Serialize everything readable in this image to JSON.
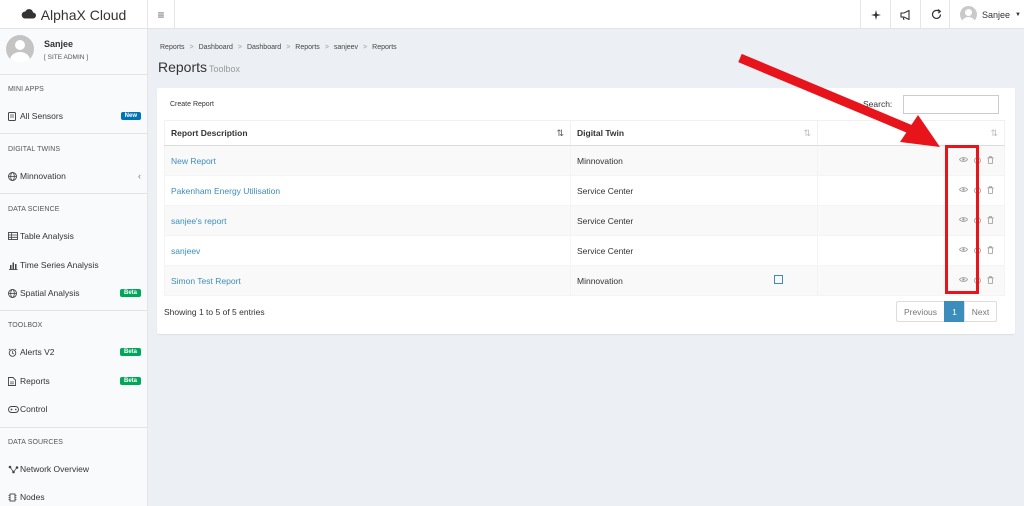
{
  "app": {
    "brand": "AlphaX Cloud",
    "user_menu_name": "Sanjee"
  },
  "sidebar": {
    "user": {
      "name": "Sanjee",
      "role": "[ SITE ADMIN ]"
    },
    "sections": {
      "mini_apps": "MINI APPS",
      "digital_twins": "DIGITAL TWINS",
      "data_science": "DATA SCIENCE",
      "toolbox": "TOOLBOX",
      "data_sources": "DATA SOURCES"
    },
    "items": {
      "all_sensors": {
        "label": "All Sensors",
        "badge": "New"
      },
      "minnovation": {
        "label": "Minnovation"
      },
      "table_analysis": {
        "label": "Table Analysis"
      },
      "time_series": {
        "label": "Time Series Analysis"
      },
      "spatial": {
        "label": "Spatial Analysis",
        "badge": "Beta"
      },
      "alerts": {
        "label": "Alerts V2",
        "badge": "Beta"
      },
      "reports": {
        "label": "Reports",
        "badge": "Beta"
      },
      "control": {
        "label": "Control"
      },
      "network": {
        "label": "Network Overview"
      },
      "nodes": {
        "label": "Nodes"
      }
    }
  },
  "breadcrumb": [
    "Reports",
    "Dashboard",
    "Dashboard",
    "Reports",
    "sanjeev",
    "Reports"
  ],
  "page": {
    "title": "Reports",
    "subtitle": "Toolbox"
  },
  "box": {
    "create_label": "Create Report",
    "search_label": "Search:",
    "search_value": ""
  },
  "table": {
    "headers": [
      "Report Description",
      "Digital Twin",
      ""
    ],
    "rows": [
      {
        "description": "New Report",
        "twin": "Minnovation"
      },
      {
        "description": "Pakenham Energy Utilisation",
        "twin": "Service Center"
      },
      {
        "description": "sanjee's report",
        "twin": "Service Center"
      },
      {
        "description": "sanjeev",
        "twin": "Service Center"
      },
      {
        "description": "Simon Test Report",
        "twin": "Minnovation"
      }
    ]
  },
  "footer": {
    "info": "Showing 1 to 5 of 5 entries",
    "prev": "Previous",
    "page": "1",
    "next": "Next"
  },
  "icons": {
    "row_actions": [
      "eye-icon",
      "power-icon",
      "trash-icon"
    ],
    "topbar": [
      "sparkle-icon",
      "megaphone-icon",
      "refresh-icon"
    ]
  },
  "colors": {
    "link": "#3c8dbc",
    "annotation": "#e8141b",
    "badge_new": "#0073b7",
    "badge_beta": "#00a65a"
  }
}
